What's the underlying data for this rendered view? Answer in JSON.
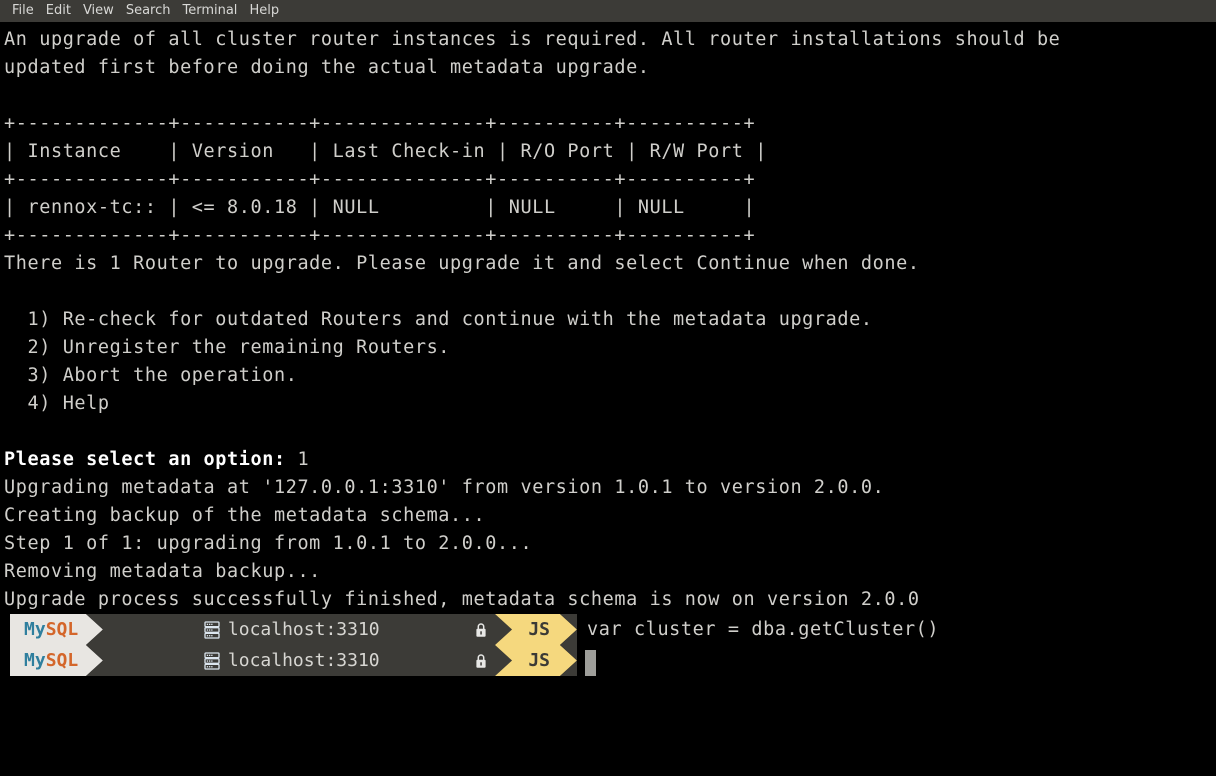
{
  "menubar": {
    "items": [
      {
        "label": "File"
      },
      {
        "label": "Edit"
      },
      {
        "label": "View"
      },
      {
        "label": "Search"
      },
      {
        "label": "Terminal"
      },
      {
        "label": "Help"
      }
    ]
  },
  "terminal": {
    "lines": [
      "An upgrade of all cluster router instances is required. All router installations should be",
      "updated first before doing the actual metadata upgrade.",
      "",
      "+-------------+-----------+--------------+----------+----------+",
      "| Instance    | Version   | Last Check-in | R/O Port | R/W Port |",
      "+-------------+-----------+--------------+----------+----------+",
      "| rennox-tc:: | <= 8.0.18 | NULL         | NULL     | NULL     |",
      "+-------------+-----------+--------------+----------+----------+",
      "There is 1 Router to upgrade. Please upgrade it and select Continue when done.",
      "",
      "  1) Re-check for outdated Routers and continue with the metadata upgrade.",
      "  2) Unregister the remaining Routers.",
      "  3) Abort the operation.",
      "  4) Help",
      ""
    ],
    "prompt_question": "Please select an option: ",
    "prompt_answer": "1",
    "output_lines": [
      "Upgrading metadata at '127.0.0.1:3310' from version 1.0.1 to version 2.0.0.",
      "Creating backup of the metadata schema...",
      "Step 1 of 1: upgrading from 1.0.1 to 2.0.0...",
      "Removing metadata backup...",
      "Upgrade process successfully finished, metadata schema is now on version 2.0.0"
    ]
  },
  "prompt_bar": {
    "brand_prefix": "My",
    "brand_suffix": "SQL",
    "host": "localhost:3310",
    "host_icon": "server-rack-icon",
    "lock_icon": "lock-icon",
    "mode": "JS",
    "command": "var cluster = dba.getCluster()",
    "command_empty": ""
  },
  "colors": {
    "background": "#000000",
    "foreground": "#d0cfcb",
    "menubar_bg": "#3c3b37",
    "brand_bg": "#e8e6e2",
    "brand_my": "#2f7f9e",
    "brand_sql": "#d4662a",
    "host_bg": "#3c3b37",
    "mode_bg": "#f5d87e",
    "mode_fg": "#3b3a36",
    "cursor": "#9e9e9a"
  }
}
